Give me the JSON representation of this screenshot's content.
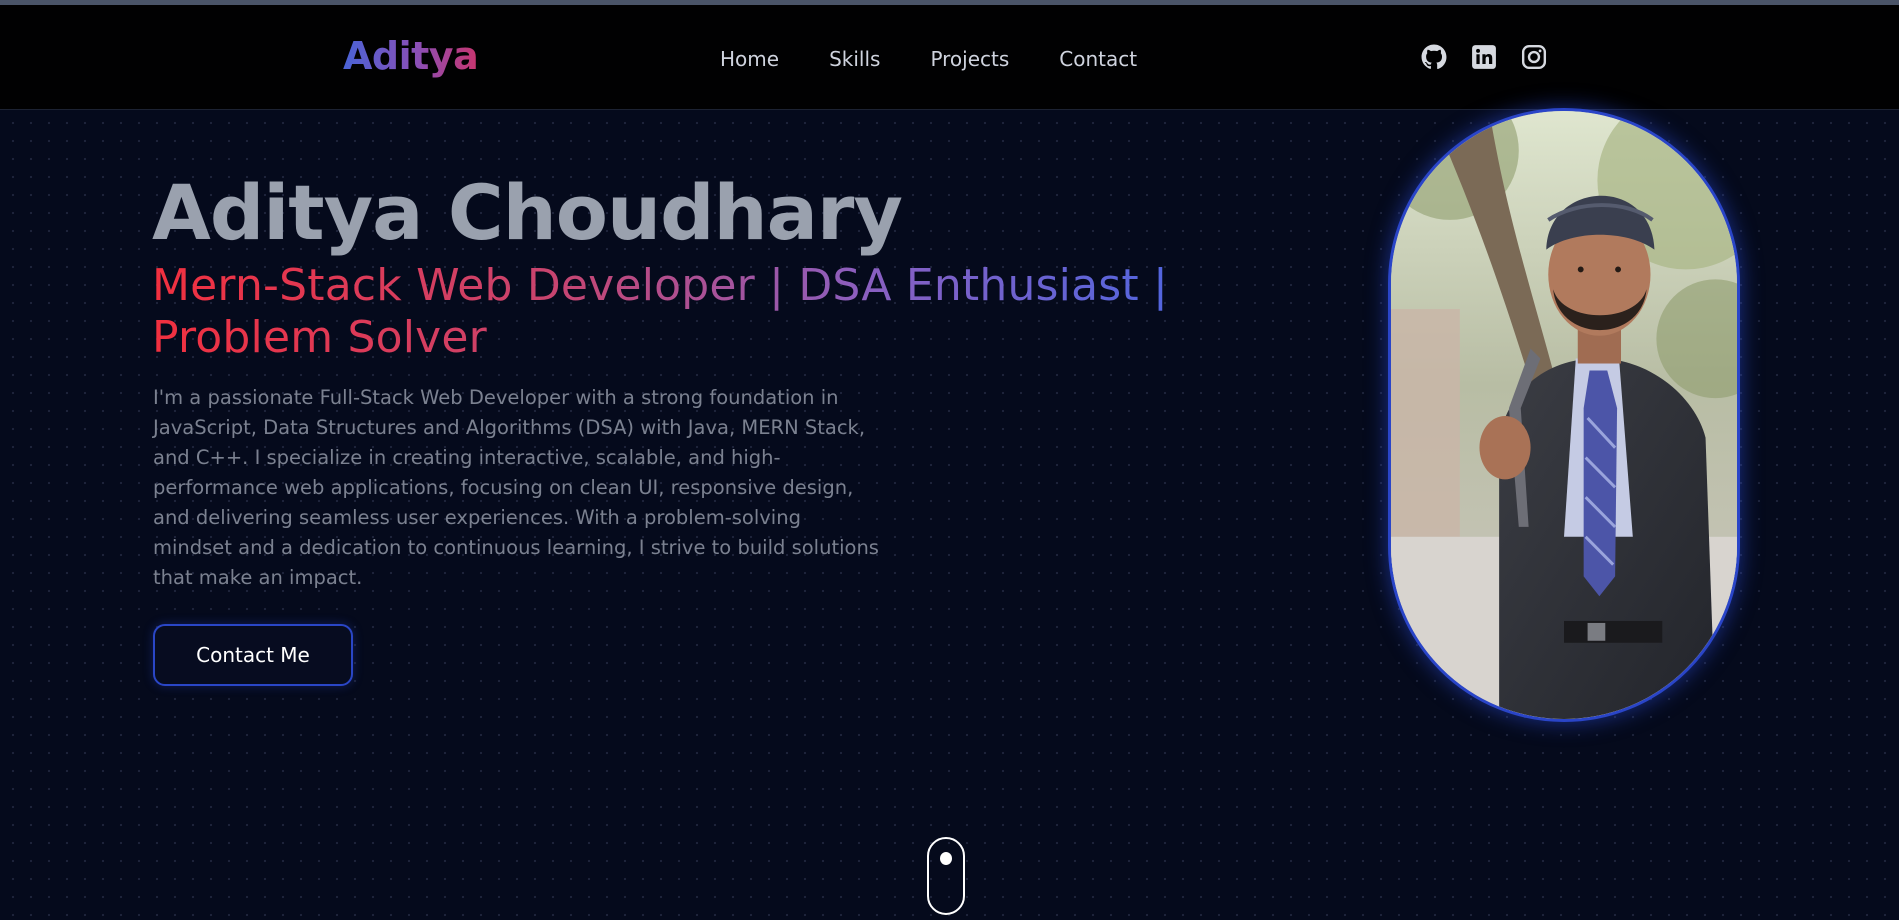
{
  "nav": {
    "logo": "Aditya",
    "links": [
      "Home",
      "Skills",
      "Projects",
      "Contact"
    ],
    "socials": [
      "github-icon",
      "linkedin-icon",
      "instagram-icon"
    ]
  },
  "hero": {
    "name": "Aditya Choudhary",
    "subtitle": "Mern-Stack Web Developer | DSA Enthusiast | Problem Solver",
    "description": "I'm a passionate Full-Stack Web Developer with a strong foundation in JavaScript, Data Structures and Algorithms (DSA) with Java, MERN Stack, and C++. I specialize in creating interactive, scalable, and high-performance web applications, focusing on clean UI, responsive design, and delivering seamless user experiences. With a problem-solving mindset and a dedication to continuous learning, I strive to build solutions that make an impact.",
    "cta_label": "Contact Me"
  },
  "colors": {
    "background": "#050a1c",
    "navbar": "#010102",
    "accent_blue": "#2a45c8",
    "gradient_red": "#f2303f",
    "gradient_blue": "#4c66e2",
    "name_gray": "#9aa1ae",
    "text_gray": "#7b8190"
  }
}
